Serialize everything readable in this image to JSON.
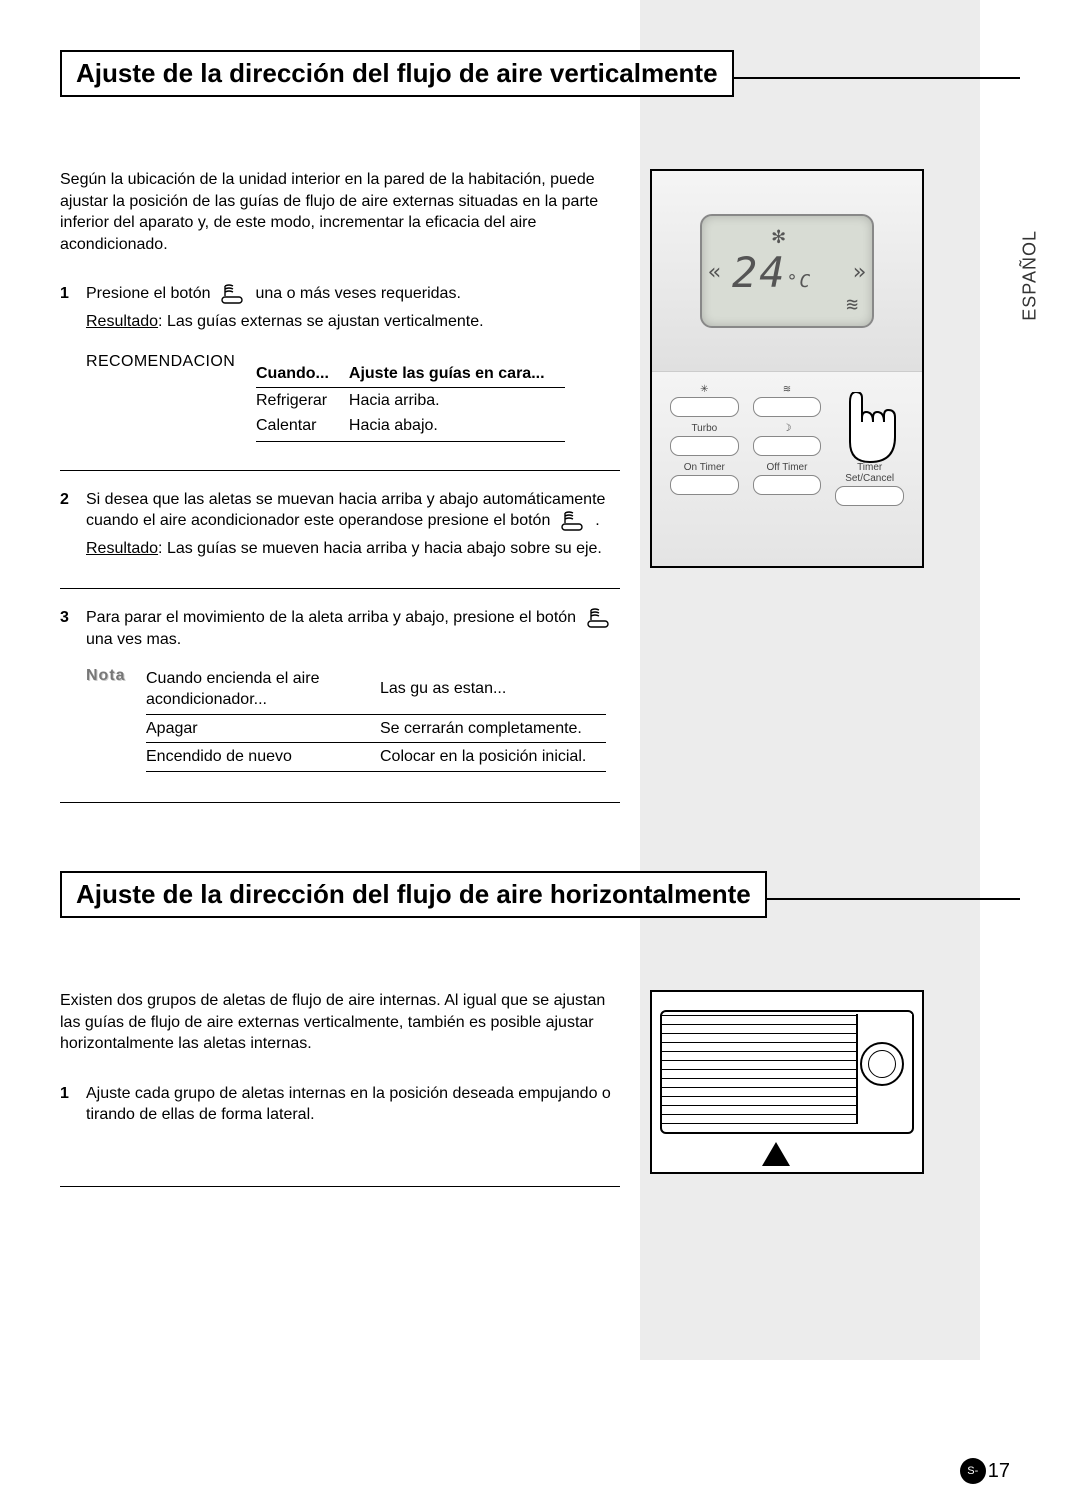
{
  "language_label": "ESPAÑOL",
  "section1": {
    "title": "Ajuste de la dirección del flujo de aire verticalmente",
    "intro": "Según la ubicación de la unidad interior en la pared de la habitación, puede ajustar la posición de las guías de flujo de aire externas situadas en la parte inferior del aparato y, de este modo, incrementar la eficacia del aire acondicionado.",
    "step1_pre": "Presione el botón",
    "step1_post": "una o más veses requeridas.",
    "step1_result_label": "Resultado",
    "step1_result_text": ": Las guías externas se ajustan verticalmente.",
    "recomendacion_label": "RECOMENDACION",
    "reco_head_when": "Cuando...",
    "reco_head_set": "Ajuste las guías en cara...",
    "reco_rows": [
      {
        "when": "Refrigerar",
        "set": "Hacia arriba."
      },
      {
        "when": "Calentar",
        "set": "Hacia abajo."
      }
    ],
    "step2_pre": "Si desea que las aletas se muevan hacia arriba y abajo automáticamente cuando el aire acondicionador este operandose presione el botón",
    "step2_post": ".",
    "step2_result_label": "Resultado",
    "step2_result_text": ": Las guías se mueven hacia arriba y hacia abajo sobre su eje.",
    "step3_pre": "Para parar el movimiento de la aleta arriba y abajo, presione el botón",
    "step3_post": "una ves mas.",
    "nota_label": "Nota",
    "nota_head_a": "Cuando encienda el aire acondicionador...",
    "nota_head_b": "Las gu as estan...",
    "nota_rows": [
      {
        "a": "Apagar",
        "b": "Se cerrarán completamente."
      },
      {
        "a": "Encendido de nuevo",
        "b": "Colocar en la posición inicial."
      }
    ]
  },
  "section2": {
    "title": "Ajuste de la dirección del flujo de aire horizontalmente",
    "intro": "Existen dos grupos de aletas de flujo de aire internas. Al igual que se ajustan las guías de flujo de aire externas verticalmente, también es posible ajustar horizontalmente las aletas internas.",
    "step1": "Ajuste cada grupo de aletas internas en la posición deseada empujando o tirando de ellas de forma lateral."
  },
  "remote": {
    "temp": "24",
    "unit": "°C",
    "btn_labels": [
      "",
      "",
      "",
      "Turbo",
      "",
      "",
      "On Timer",
      "Off Timer",
      "Timer Set/Cancel"
    ]
  },
  "page_number_prefix": "S-",
  "page_number": "17"
}
